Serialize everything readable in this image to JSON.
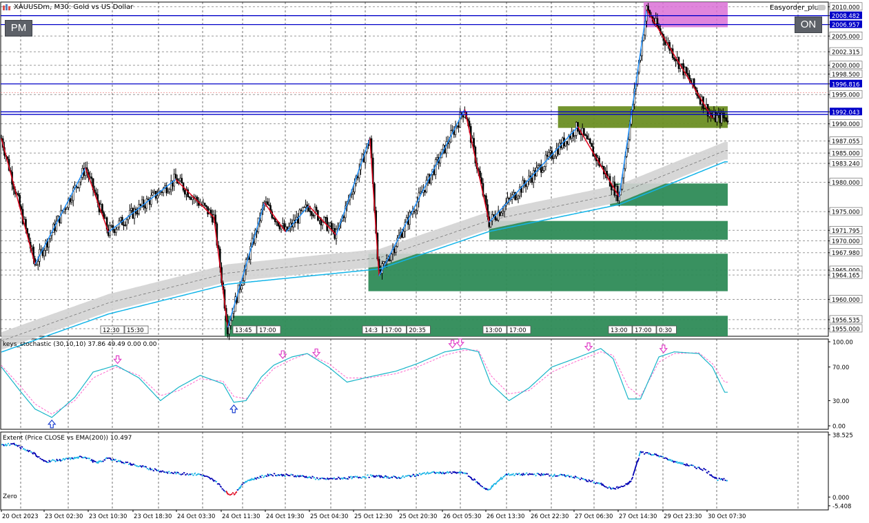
{
  "window": {
    "symbol_title": "XAUUSDm, M30:  Gold vs US Dollar",
    "ea_name": "Easyorder_plus",
    "pm_button": "PM",
    "on_button": "ON"
  },
  "colors": {
    "bull_candle": "#000000",
    "zigzag_up": "#1e90ff",
    "zigzag_down": "#e0001a",
    "ema_line": "#12b4e8",
    "ema_band": "#d3d3d3",
    "horizontal_line": "#0000c8",
    "demand_zone": "#2e8b57",
    "demand_zone_light": "#19b48a",
    "supply_zone": "#da70d6",
    "olive_zone": "#6b8e23",
    "stoch_main": "#17b5c8",
    "stoch_signal": "#ff66cc",
    "extent_light": "#19b4e6",
    "extent_dark": "#0000b4",
    "extent_red": "#e0001a"
  },
  "price_axis": {
    "labels": [
      {
        "v": 2010.0,
        "t": "2010.000",
        "hl": false
      },
      {
        "v": 2008.482,
        "t": "2008.482",
        "hl": true
      },
      {
        "v": 2006.957,
        "t": "2006.957",
        "hl": true
      },
      {
        "v": 2005.0,
        "t": "2005.000",
        "hl": false
      },
      {
        "v": 2002.315,
        "t": "2002.315",
        "hl": false
      },
      {
        "v": 2000.0,
        "t": "2000.000",
        "hl": false
      },
      {
        "v": 1998.5,
        "t": "1998.500",
        "hl": false
      },
      {
        "v": 1996.816,
        "t": "1996.816",
        "hl": true
      },
      {
        "v": 1995.0,
        "t": "1995.000",
        "hl": false
      },
      {
        "v": 1992.043,
        "t": "1992.043",
        "hl": true
      },
      {
        "v": 1990.0,
        "t": "1990.000",
        "hl": false
      },
      {
        "v": 1987.055,
        "t": "1987.055",
        "hl": false
      },
      {
        "v": 1985.0,
        "t": "1985.000",
        "hl": false
      },
      {
        "v": 1983.24,
        "t": "1983.240",
        "hl": false
      },
      {
        "v": 1980.0,
        "t": "1980.000",
        "hl": false
      },
      {
        "v": 1975.0,
        "t": "1975.000",
        "hl": false
      },
      {
        "v": 1971.795,
        "t": "1971.795",
        "hl": false
      },
      {
        "v": 1970.0,
        "t": "1970.000",
        "hl": false
      },
      {
        "v": 1967.98,
        "t": "1967.980",
        "hl": false
      },
      {
        "v": 1965.0,
        "t": "1965.000",
        "hl": false
      },
      {
        "v": 1964.165,
        "t": "1964.165",
        "hl": false
      },
      {
        "v": 1960.0,
        "t": "1960.000",
        "hl": false
      },
      {
        "v": 1956.535,
        "t": "1956.535",
        "hl": false
      },
      {
        "v": 1955.0,
        "t": "1955.000",
        "hl": false
      }
    ]
  },
  "time_axis": {
    "labels": [
      "20 Oct 2023",
      "23 Oct 02:30",
      "23 Oct 10:30",
      "23 Oct 18:30",
      "24 Oct 03:30",
      "24 Oct 11:30",
      "24 Oct 19:30",
      "25 Oct 04:30",
      "25 Oct 12:30",
      "25 Oct 20:30",
      "26 Oct 05:30",
      "26 Oct 13:30",
      "26 Oct 22:30",
      "27 Oct 06:30",
      "27 Oct 14:30",
      "29 Oct 23:30",
      "30 Oct 07:30"
    ]
  },
  "session_tags": [
    [
      "12:30",
      "15:30"
    ],
    [
      "13:45",
      "17:00"
    ],
    [
      "14:3",
      "17:00",
      "20:35"
    ],
    [
      "13:00",
      "17:00"
    ],
    [
      "13:00",
      "17:00",
      "0:30"
    ]
  ],
  "horizontal_levels": [
    2008.482,
    2006.957,
    1996.816,
    1992.043,
    1991.6
  ],
  "chart_data": [
    {
      "type": "candlestick",
      "title": "XAUUSDm, M30:  Gold vs US Dollar",
      "ylim": [
        1953.7,
        2010.8
      ],
      "grid": true,
      "zigzag": [
        {
          "i": 0,
          "p": 1987.5
        },
        {
          "i": 22,
          "p": 1966.0
        },
        {
          "i": 55,
          "p": 1982.5
        },
        {
          "i": 70,
          "p": 1971.5
        },
        {
          "i": 114,
          "p": 1980.5
        },
        {
          "i": 139,
          "p": 1974.0
        },
        {
          "i": 148,
          "p": 1955.2
        },
        {
          "i": 172,
          "p": 1976.5
        },
        {
          "i": 186,
          "p": 1971.5
        },
        {
          "i": 201,
          "p": 1976.0
        },
        {
          "i": 219,
          "p": 1971.0
        },
        {
          "i": 241,
          "p": 1987.5
        },
        {
          "i": 247,
          "p": 1964.0
        },
        {
          "i": 303,
          "p": 1992.5
        },
        {
          "i": 319,
          "p": 1973.2
        },
        {
          "i": 377,
          "p": 1989.5
        },
        {
          "i": 404,
          "p": 1977.5
        },
        {
          "i": 422,
          "p": 2009.5
        },
        {
          "i": 465,
          "p": 1991.0
        }
      ],
      "ema200": [
        {
          "i": 0,
          "p": 1951.0
        },
        {
          "i": 70,
          "p": 1957.5
        },
        {
          "i": 148,
          "p": 1962.6
        },
        {
          "i": 247,
          "p": 1965.2
        },
        {
          "i": 319,
          "p": 1971.6
        },
        {
          "i": 404,
          "p": 1976.2
        },
        {
          "i": 440,
          "p": 1980.0
        },
        {
          "i": 473,
          "p": 1983.5
        }
      ],
      "zones": [
        {
          "kind": "supply",
          "i0": 420,
          "i1": 475,
          "p0": 2006.5,
          "p1": 2010.8
        },
        {
          "kind": "olive",
          "i0": 364,
          "i1": 475,
          "p0": 1989.3,
          "p1": 1993.0
        },
        {
          "kind": "demand",
          "i0": 398,
          "i1": 475,
          "p0": 1976.0,
          "p1": 1979.8
        },
        {
          "kind": "demand",
          "i0": 319,
          "i1": 475,
          "p0": 1970.2,
          "p1": 1973.4
        },
        {
          "kind": "demand",
          "i0": 240,
          "i1": 475,
          "p0": 1961.4,
          "p1": 1967.8
        },
        {
          "kind": "demand",
          "i0": 146,
          "i1": 475,
          "p0": 1953.7,
          "p1": 1957.2
        }
      ]
    },
    {
      "type": "line",
      "title": "keys_stochastic (30,10,10) 37.86 49.49 0.00 0.00",
      "ylim": [
        0,
        100
      ],
      "yticks": [
        "100.00",
        "70.00",
        "30.00",
        "0.00"
      ],
      "x_index": [
        0,
        12,
        22,
        33,
        48,
        60,
        75,
        90,
        104,
        116,
        130,
        145,
        152,
        160,
        170,
        178,
        190,
        200,
        214,
        226,
        240,
        258,
        272,
        290,
        303,
        312,
        320,
        332,
        345,
        360,
        375,
        392,
        400,
        410,
        418,
        430,
        440,
        456,
        465,
        473
      ],
      "series": [
        {
          "values": [
            70,
            42,
            20,
            10,
            34,
            64,
            72,
            57,
            30,
            46,
            60,
            50,
            28,
            30,
            58,
            72,
            82,
            86,
            70,
            52,
            58,
            65,
            74,
            88,
            92,
            88,
            50,
            30,
            45,
            70,
            80,
            92,
            80,
            32,
            32,
            82,
            88,
            86,
            70,
            40
          ]
        },
        {
          "values": [
            72,
            48,
            26,
            14,
            30,
            57,
            70,
            60,
            36,
            42,
            56,
            53,
            35,
            32,
            52,
            68,
            79,
            86,
            74,
            57,
            57,
            62,
            70,
            84,
            90,
            90,
            60,
            38,
            42,
            64,
            76,
            88,
            84,
            46,
            35,
            76,
            86,
            87,
            74,
            52
          ]
        }
      ],
      "arrows": [
        {
          "i": 33,
          "dir": "up"
        },
        {
          "i": 76,
          "dir": "down"
        },
        {
          "i": 152,
          "dir": "up"
        },
        {
          "i": 184,
          "dir": "down"
        },
        {
          "i": 206,
          "dir": "down"
        },
        {
          "i": 295,
          "dir": "down"
        },
        {
          "i": 300,
          "dir": "down"
        },
        {
          "i": 384,
          "dir": "down"
        },
        {
          "i": 433,
          "dir": "down"
        }
      ]
    },
    {
      "type": "line",
      "title": "Extent (Price CLOSE vs EMA(200)) 10.497",
      "ylim": [
        -5.408,
        38.525
      ],
      "yticks": [
        "38.525",
        "0.000",
        "-5.408"
      ],
      "label": "Zero",
      "x_index": [
        0,
        8,
        14,
        20,
        28,
        40,
        55,
        62,
        70,
        90,
        110,
        130,
        140,
        148,
        152,
        160,
        176,
        196,
        210,
        230,
        242,
        260,
        280,
        303,
        318,
        330,
        352,
        372,
        392,
        400,
        408,
        412,
        418,
        428,
        440,
        460,
        468,
        473
      ],
      "series": [
        {
          "values": [
            32,
            33,
            30,
            28,
            22,
            23,
            25,
            21,
            24,
            19,
            15,
            14,
            10,
            2,
            2,
            10,
            14,
            13,
            11,
            12,
            13,
            12,
            15,
            15,
            4,
            14,
            14,
            13,
            8,
            5,
            7,
            10,
            28,
            26,
            22,
            17,
            11,
            10.5
          ]
        }
      ]
    }
  ]
}
